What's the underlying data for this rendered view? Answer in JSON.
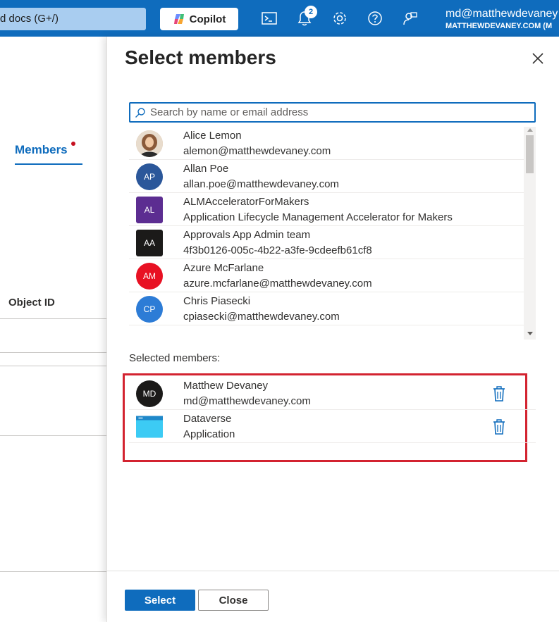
{
  "topbar": {
    "search_text": "d docs (G+/)",
    "copilot_label": "Copilot",
    "notification_count": "2",
    "account_name": "md@matthewdevaney",
    "account_tenant": "MATTHEWDEVANEY.COM (M"
  },
  "background": {
    "members_tab": "Members",
    "object_id_header": "Object ID"
  },
  "panel": {
    "title": "Select members",
    "search_placeholder": "Search by name or email address",
    "results": [
      {
        "name": "Alice Lemon",
        "sub": "alemon@matthewdevaney.com",
        "initials": "",
        "color": "#c8a27a"
      },
      {
        "name": "Allan Poe",
        "sub": "allan.poe@matthewdevaney.com",
        "initials": "AP",
        "color": "#2b579a"
      },
      {
        "name": "ALMAcceleratorForMakers",
        "sub": "Application Lifecycle Management Accelerator for Makers",
        "initials": "AL",
        "color": "#5c2d91"
      },
      {
        "name": "Approvals App Admin team",
        "sub": "4f3b0126-005c-4b22-a3fe-9cdeefb61cf8",
        "initials": "AA",
        "color": "#1b1a19"
      },
      {
        "name": "Azure McFarlane",
        "sub": "azure.mcfarlane@matthewdevaney.com",
        "initials": "AM",
        "color": "#e81123"
      },
      {
        "name": "Chris Piasecki",
        "sub": "cpiasecki@matthewdevaney.com",
        "initials": "CP",
        "color": "#2d7cd6"
      }
    ],
    "selected_label": "Selected members:",
    "selected": [
      {
        "name": "Matthew Devaney",
        "sub": "md@matthewdevaney.com",
        "initials": "MD",
        "color": "#1b1a19"
      },
      {
        "name": "Dataverse",
        "sub": "Application",
        "initials": "",
        "color": "#2fb5e8"
      }
    ],
    "select_button": "Select",
    "close_button": "Close"
  }
}
